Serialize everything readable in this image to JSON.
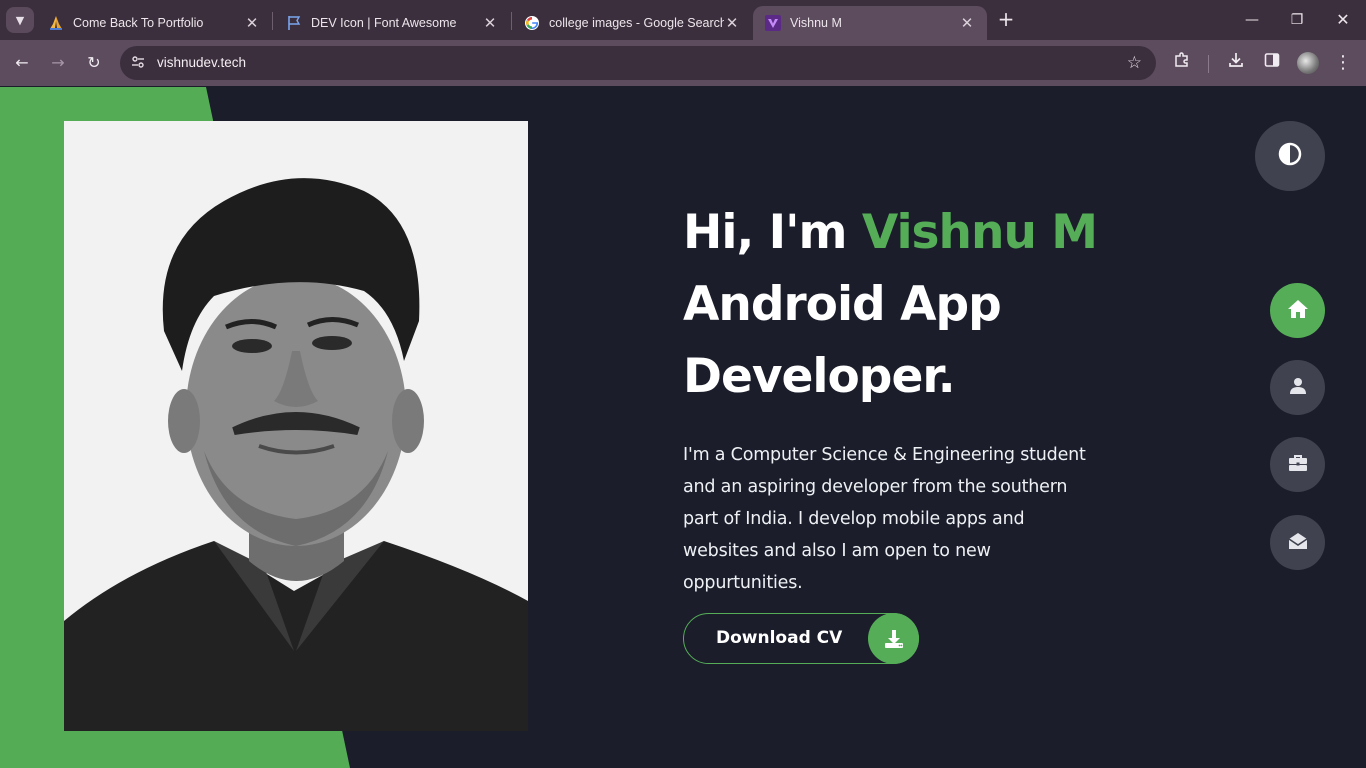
{
  "browser": {
    "tabs": [
      {
        "title": "Come Back To Portfolio",
        "icon": "praying-hands-favicon",
        "active": false
      },
      {
        "title": "DEV Icon | Font Awesome",
        "icon": "flag-favicon",
        "active": false
      },
      {
        "title": "college images - Google Search",
        "icon": "google-favicon",
        "active": false
      },
      {
        "title": "Vishnu M",
        "icon": "vite-favicon",
        "active": true
      }
    ],
    "url": "vishnudev.tech"
  },
  "hero": {
    "greeting": "Hi, I'm ",
    "name": "Vishnu M",
    "role_line1": "Android App",
    "role_line2": "Developer.",
    "bio": "I'm a Computer Science & Engineering student and an aspiring developer from the southern part of India. I develop mobile apps and websites and also I am open to new oppurtunities.",
    "cta_label": "Download CV"
  },
  "nav": {
    "items": [
      {
        "id": "home",
        "icon": "home-icon",
        "active": true
      },
      {
        "id": "about",
        "icon": "user-icon",
        "active": false
      },
      {
        "id": "portfolio",
        "icon": "briefcase-icon",
        "active": false
      },
      {
        "id": "contact",
        "icon": "envelope-open-icon",
        "active": false
      }
    ],
    "theme_toggle_icon": "contrast-icon"
  },
  "colors": {
    "accent": "#55ae57",
    "background": "#1b1d2b",
    "button_grey": "#40434f"
  }
}
